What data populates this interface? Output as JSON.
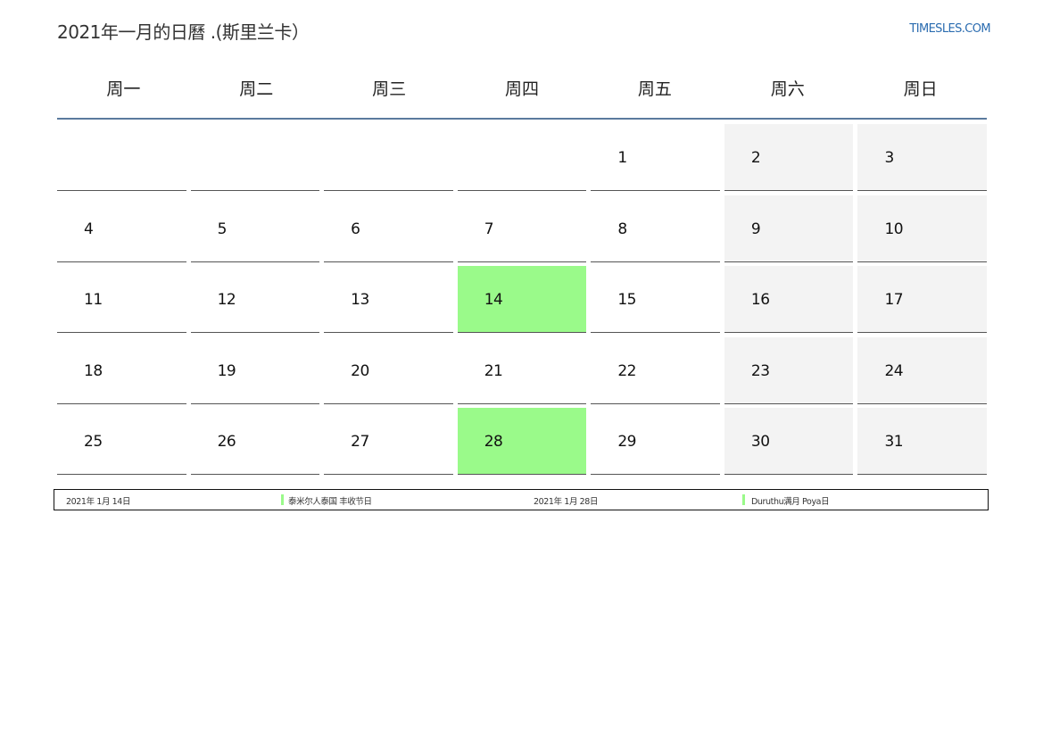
{
  "header": {
    "title": "2021年一月的日曆 .(斯里兰卡）",
    "site": "TIMESLES.COM"
  },
  "weekdays": [
    "周一",
    "周二",
    "周三",
    "周四",
    "周五",
    "周六",
    "周日"
  ],
  "weeks": [
    [
      "",
      "",
      "",
      "",
      "1",
      "2",
      "3"
    ],
    [
      "4",
      "5",
      "6",
      "7",
      "8",
      "9",
      "10"
    ],
    [
      "11",
      "12",
      "13",
      "14",
      "15",
      "16",
      "17"
    ],
    [
      "18",
      "19",
      "20",
      "21",
      "22",
      "23",
      "24"
    ],
    [
      "25",
      "26",
      "27",
      "28",
      "29",
      "30",
      "31"
    ]
  ],
  "holiday_days": [
    "14",
    "28"
  ],
  "colors": {
    "holiday": "#9afa8a",
    "weekend": "#f3f3f3",
    "header_rule": "#5b7a9e",
    "link": "#2b6cb0"
  },
  "legend": [
    {
      "date": "2021年 1月 14日",
      "name": "泰米尔人泰国 丰收节日"
    },
    {
      "date": "2021年 1月 28日",
      "name": "Duruthu满月 Poya日"
    }
  ]
}
